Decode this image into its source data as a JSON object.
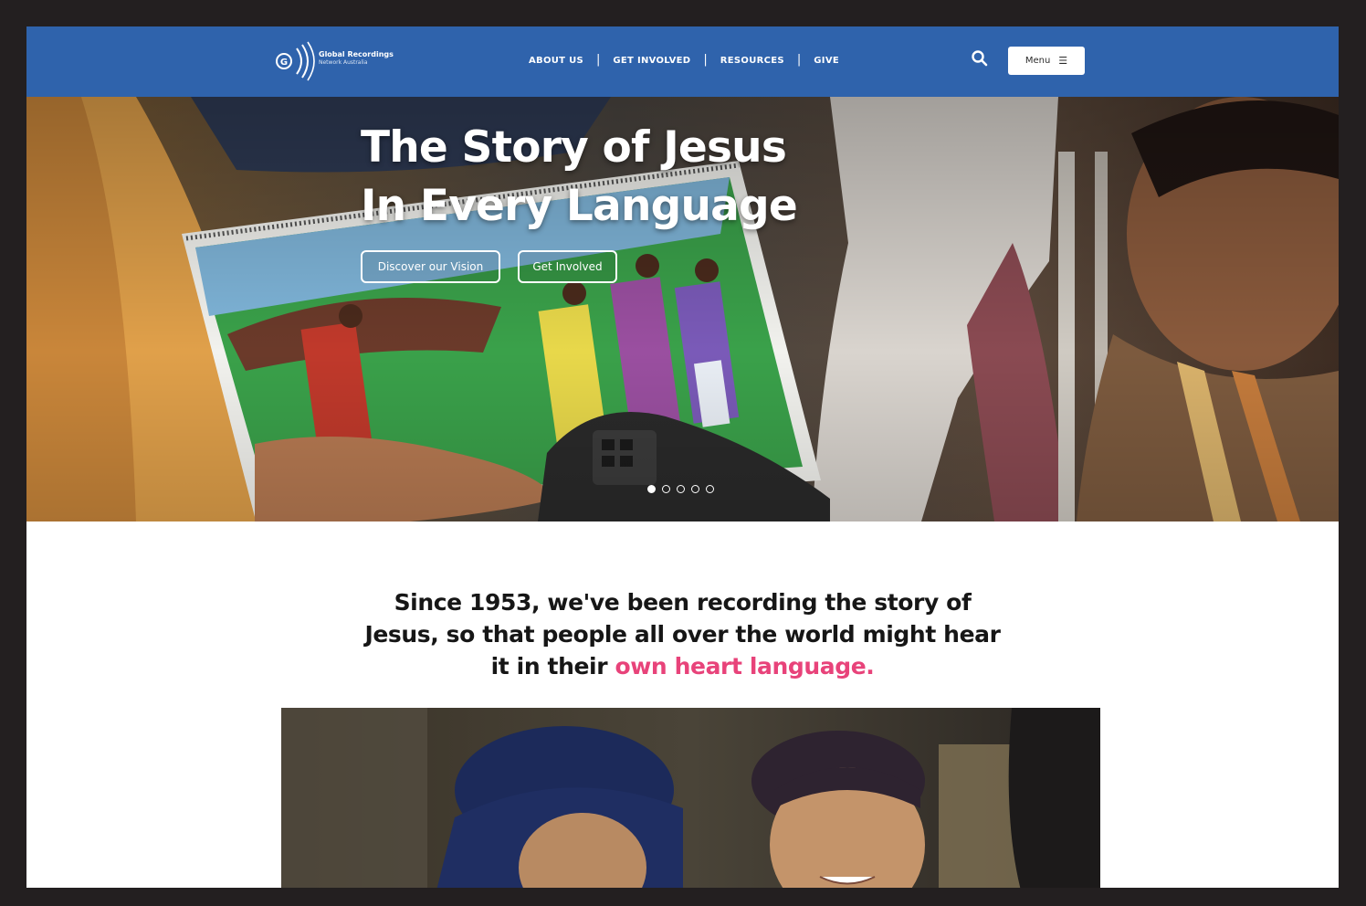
{
  "header": {
    "logo_mark": "G|R|N",
    "logo_title": "Global Recordings",
    "logo_subtitle": "Network Australia",
    "nav": [
      {
        "label": "ABOUT US"
      },
      {
        "label": "GET INVOLVED"
      },
      {
        "label": "RESOURCES"
      },
      {
        "label": "GIVE"
      }
    ],
    "nav_separator": "|",
    "search_icon": "search-icon",
    "menu_label": "Menu",
    "menu_icon": "hamburger-icon"
  },
  "hero": {
    "heading_line1": "The Story of Jesus",
    "heading_line2": "In Every Language",
    "button_vision": "Discover our Vision",
    "button_involved": "Get Involved",
    "slides_total": 5,
    "slide_active": 1
  },
  "intro": {
    "text_line1": "Since 1953, we've been recording the story of",
    "text_line2": "Jesus, so that people all over the world might hear",
    "text_line3_prefix": "it in their ",
    "text_highlight": "own heart language."
  },
  "colors": {
    "header_bg": "#2f63ac",
    "highlight": "#e8437a",
    "frame": "#231f20"
  }
}
